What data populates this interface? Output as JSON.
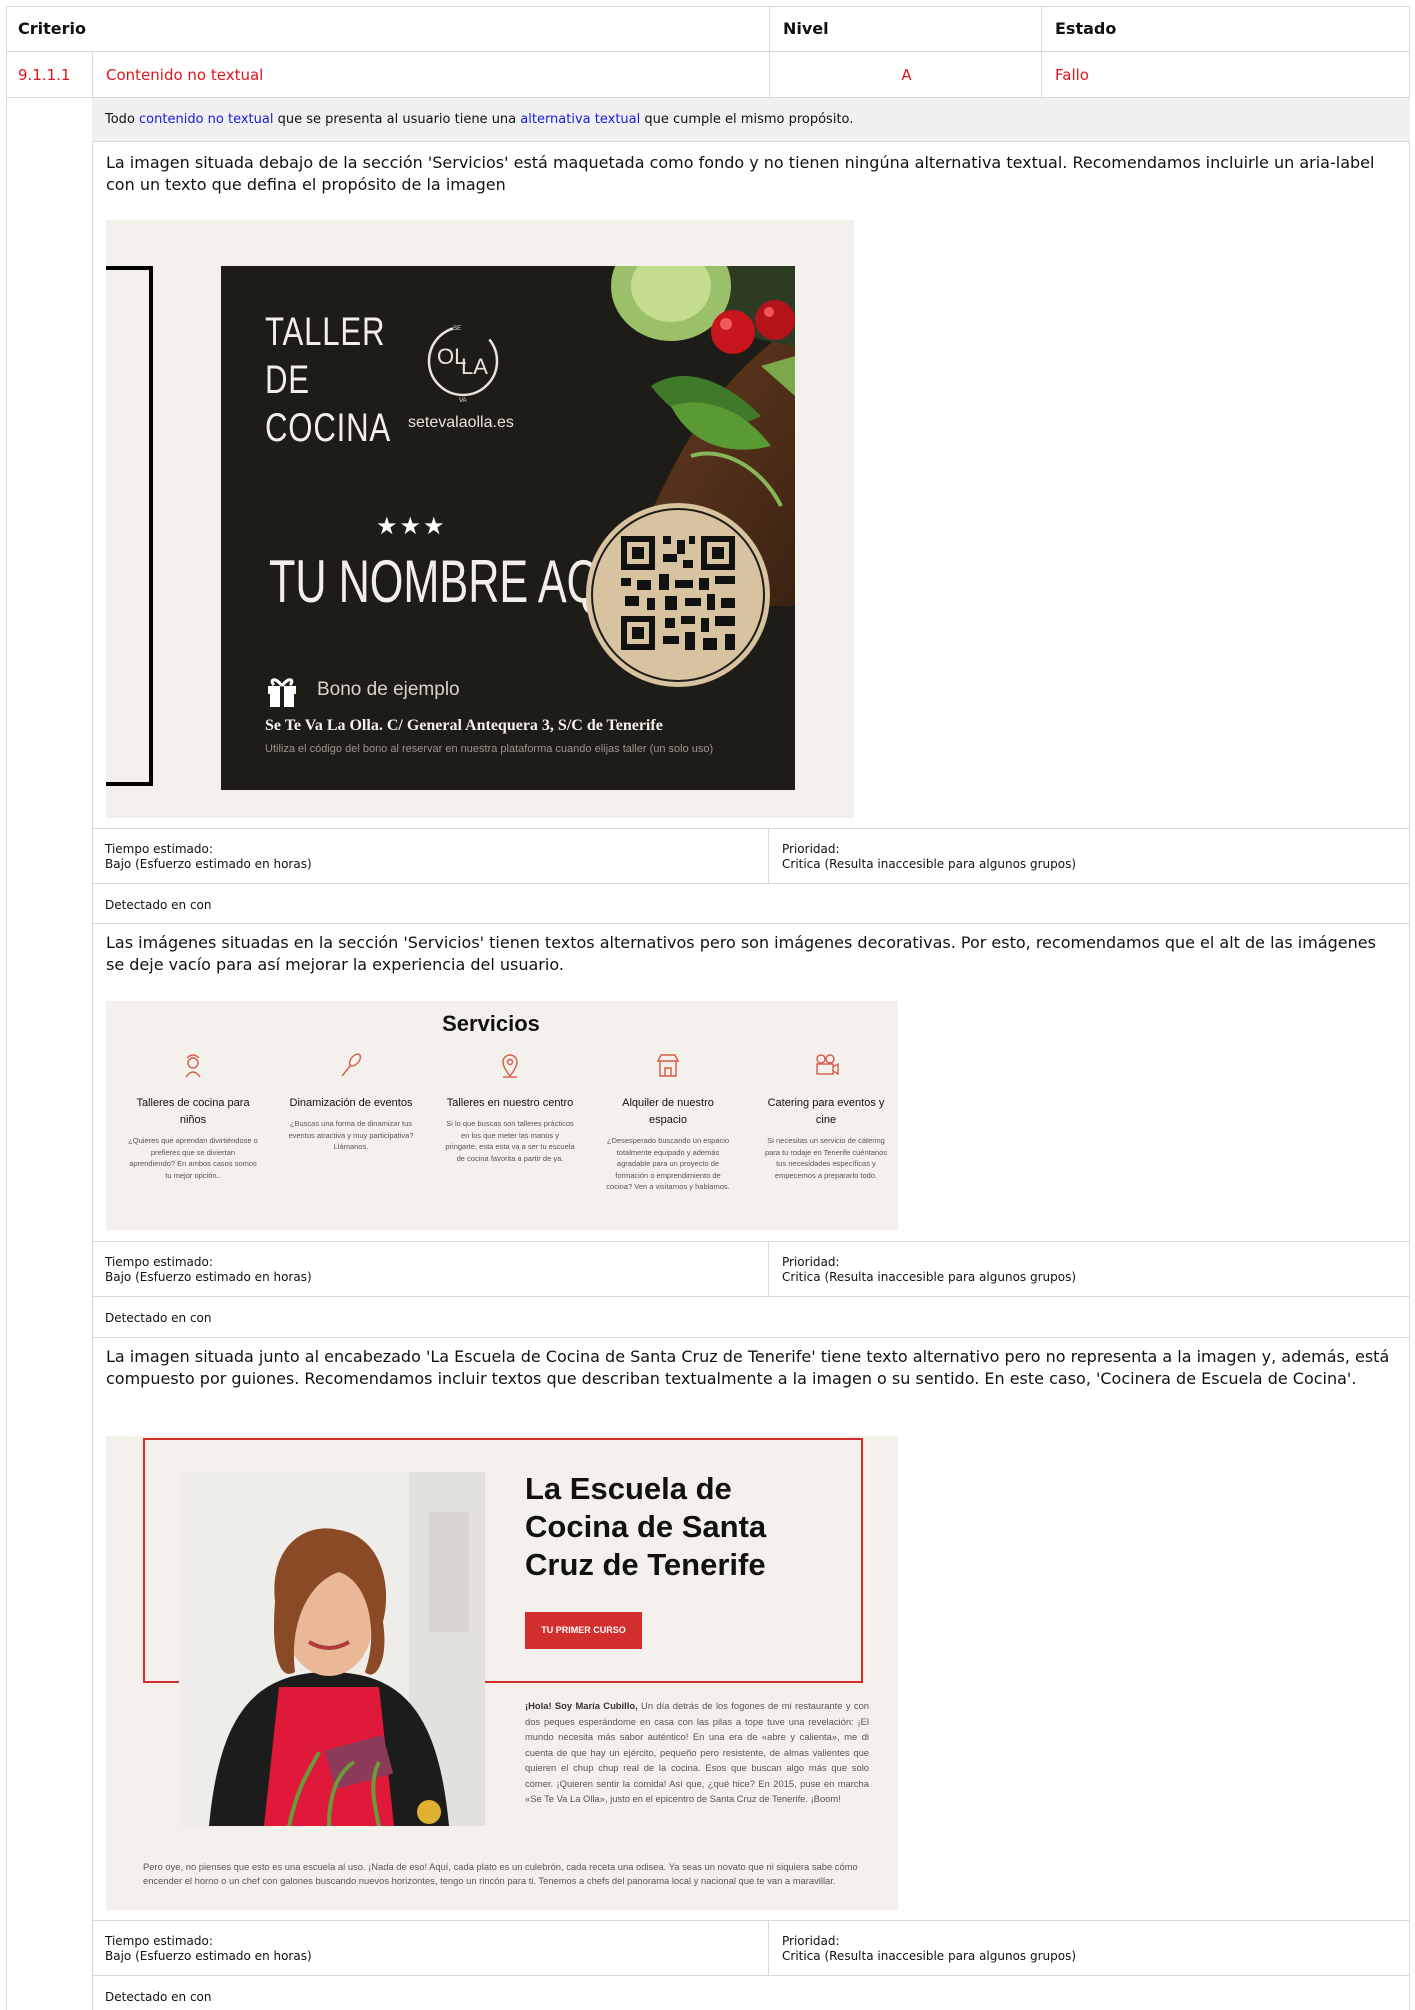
{
  "header": {
    "col_criterio": "Criterio",
    "col_nivel": "Nivel",
    "col_estado": "Estado"
  },
  "criterion": {
    "id": "9.1.1.1",
    "name": "Contenido no textual",
    "level": "A",
    "status": "Fallo"
  },
  "description": {
    "prefix": "Todo ",
    "link1": "contenido no textual",
    "middle": " que se presenta al usuario tiene una ",
    "link2": "alternativa textual",
    "suffix": " que cumple el mismo propósito."
  },
  "issues": [
    {
      "text": "La imagen situada debajo de la sección 'Servicios' está maquetada como fondo y no tienen ningúna alternativa textual. Recomendamos incluirle un aria-label con un texto que defina el propósito de la imagen",
      "time_label": "Tiempo estimado:",
      "time_value": "Bajo (Esfuerzo estimado en horas)",
      "priority_label": "Prioridad:",
      "priority_value": "Critica (Resulta inaccesible para algunos grupos)",
      "detected": "Detectado en con"
    },
    {
      "text": "Las imágenes situadas en la sección 'Servicios' tienen textos alternativos pero son imágenes decorativas. Por esto, recomendamos que el alt de las imágenes se deje vacío para así mejorar la experiencia del usuario.",
      "time_label": "Tiempo estimado:",
      "time_value": "Bajo (Esfuerzo estimado en horas)",
      "priority_label": "Prioridad:",
      "priority_value": "Critica (Resulta inaccesible para algunos grupos)",
      "detected": "Detectado en con"
    },
    {
      "text": "La imagen situada junto al encabezado 'La Escuela de Cocina de Santa Cruz de Tenerife' tiene texto alternativo pero no representa a la imagen y, además, está compuesto por guiones. Recomendamos incluir textos que describan textualmente a la imagen o su sentido. En este caso, 'Cocinera de Escuela de Cocina'.",
      "time_label": "Tiempo estimado:",
      "time_value": "Bajo (Esfuerzo estimado en horas)",
      "priority_label": "Prioridad:",
      "priority_value": "Critica (Resulta inaccesible para algunos grupos)",
      "detected": "Detectado en con"
    }
  ],
  "voucher": {
    "line1": "TALLER",
    "line2": "DE",
    "line3": "COCINA",
    "website": "setevalaolla.es",
    "stars": "★★★",
    "name": "TU NOMBRE AQUÍ",
    "bono": "Bono de ejemplo",
    "address": "Se Te Va La Olla. C/ General Antequera 3, S/C de Tenerife",
    "fine": "Utiliza el código del bono al reservar en nuestra plataforma cuando elijas taller (un solo uso)"
  },
  "servicios": {
    "title": "Servicios",
    "items": [
      {
        "title": "Talleres de cocina para niños",
        "desc": "¿Quieres que aprendan divirtiéndose o prefieres que se diviertan aprendiendo? En ambos casos somos tu mejor opción.."
      },
      {
        "title": "Dinamización de eventos",
        "desc": "¿Buscas una forma de dinamizar tus eventos atractiva y muy participativa? Llámanos."
      },
      {
        "title": "Talleres en nuestro centro",
        "desc": "Si lo que buscas son talleres prácticos en los que meter las manos y pringarte, esta esta va a ser tu escuela de cocina favorita a partir de ya."
      },
      {
        "title": "Alquiler de nuestro espacio",
        "desc": "¿Desesperado buscando un espacio totalmente equipado y además agradable para un proyecto de formación o emprendimiento de cocina? Ven a visitarnos y hablamos."
      },
      {
        "title": "Catering para eventos y cine",
        "desc": "Si necesitas un servicio de cátering para tu rodaje en Tenerife cuéntanos tus necesidades específicas y empecemos a prepararlo todo."
      }
    ]
  },
  "escuela": {
    "heading": "La Escuela de Cocina de Santa Cruz de Tenerife",
    "cta": "TU PRIMER CURSO",
    "bio_bold": "¡Hola! Soy María Cubillo,",
    "bio": " Un día detrás de los fogones de mi restaurante y con dos peques esperándome en casa con las pilas a tope tuve una revelación: ¡El mundo necesita más sabor auténtico! En una era de «abre y calienta», me di cuenta de que hay un ejército, pequeño pero resistente, de almas valientes que quieren el chup chup real de la cocina. Esos que buscan algo más que solo comer. ¡Quieren sentir la comida! Así que, ¿qué hice? En 2015, puse en marcha «Se Te Va La Olla», justo en el epicentro de Santa Cruz de Tenerife. ¡Boom!",
    "footer": "Pero oye, no pienses que esto es una escuela al uso. ¡Nada de eso! Aquí, cada plato es un culebrón, cada receta una odisea. Ya seas un novato que ni siquiera sabe cómo encender el horno o un chef con galones buscando nuevos horizontes, tengo un rincón para ti. Tenemos a chefs del panorama local y nacional que te van a maravillar."
  },
  "colors": {
    "fail": "#e0141e",
    "link": "#1a1adb",
    "accent": "#d22e2e"
  }
}
